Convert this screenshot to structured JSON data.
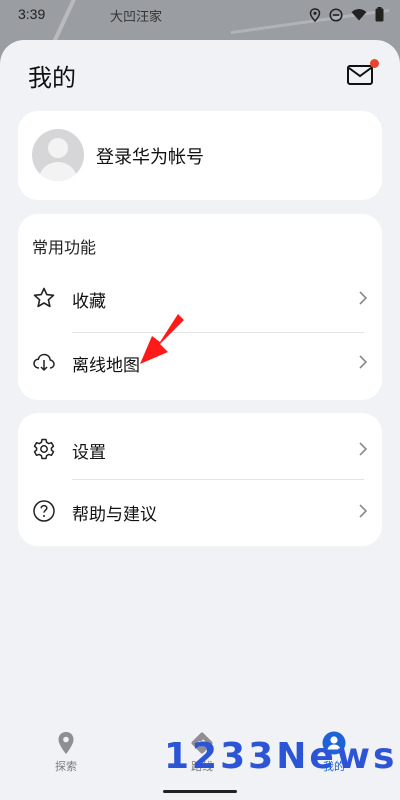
{
  "status_bar": {
    "time": "3:39",
    "map_label": "大凹汪家",
    "icons": [
      "location-icon",
      "dnd-icon",
      "wifi-icon",
      "battery-icon"
    ]
  },
  "header": {
    "title": "我的",
    "mail_icon": "mail-icon",
    "mail_badge_color": "#e8452f"
  },
  "account": {
    "login_label": "登录华为帐号",
    "avatar_icon": "avatar-placeholder"
  },
  "common_section": {
    "title": "常用功能",
    "items": [
      {
        "label": "收藏",
        "icon": "star-icon"
      },
      {
        "label": "离线地图",
        "icon": "cloud-download-icon"
      }
    ]
  },
  "settings_section": {
    "items": [
      {
        "label": "设置",
        "icon": "gear-icon"
      },
      {
        "label": "帮助与建议",
        "icon": "help-icon"
      }
    ]
  },
  "annotation": {
    "pointer_color": "#ff1a1a"
  },
  "bottom_nav": {
    "items": [
      {
        "label": "探索",
        "icon": "location-pin-icon",
        "active": false
      },
      {
        "label": "路线",
        "icon": "route-icon",
        "active": false
      },
      {
        "label": "我的",
        "icon": "profile-icon",
        "active": true
      }
    ],
    "active_color": "#1e62d8"
  },
  "watermark": {
    "text": "1233News"
  }
}
